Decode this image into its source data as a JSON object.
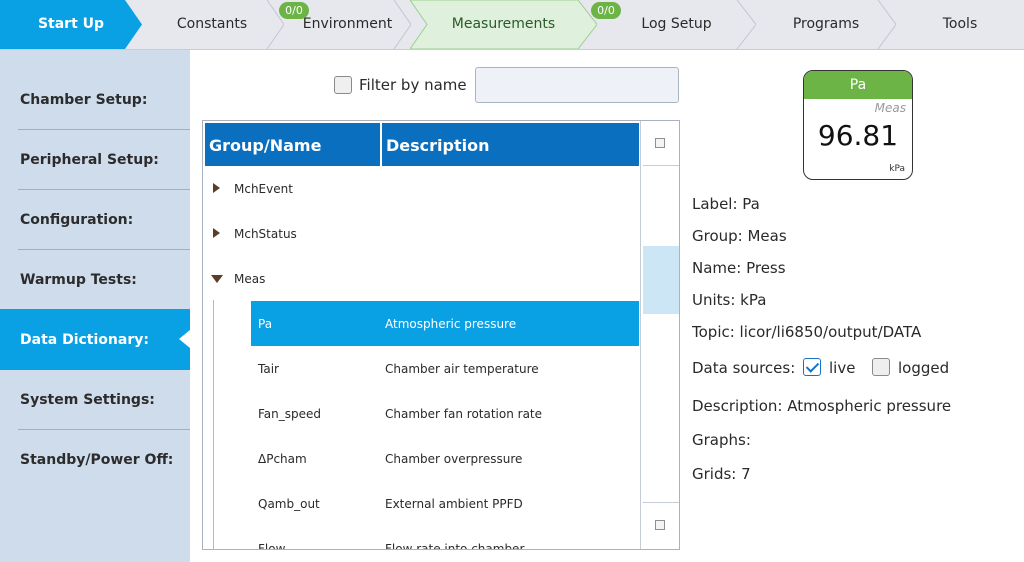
{
  "nav": {
    "tabs": [
      {
        "label": "Start Up"
      },
      {
        "label": "Constants"
      },
      {
        "label": "Environment",
        "badge": "0/0"
      },
      {
        "label": "Measurements"
      },
      {
        "label": "Log Setup",
        "badge": "0/0"
      },
      {
        "label": "Programs"
      },
      {
        "label": "Tools"
      }
    ]
  },
  "sidebar": {
    "items": [
      {
        "label": "Chamber Setup:"
      },
      {
        "label": "Peripheral Setup:"
      },
      {
        "label": "Configuration:"
      },
      {
        "label": "Warmup Tests:"
      },
      {
        "label": "Data Dictionary:"
      },
      {
        "label": "System Settings:"
      },
      {
        "label": "Standby/Power Off:"
      }
    ],
    "active_index": 4
  },
  "filter": {
    "label": "Filter by name",
    "value": "",
    "checked": false
  },
  "table": {
    "headers": {
      "name": "Group/Name",
      "description": "Description"
    },
    "rows": [
      {
        "name": "MchEvent",
        "description": ""
      },
      {
        "name": "MchStatus",
        "description": ""
      },
      {
        "name": "Meas",
        "description": ""
      },
      {
        "name": "Pa",
        "description": "Atmospheric pressure"
      },
      {
        "name": "Tair",
        "description": "Chamber air temperature"
      },
      {
        "name": "Fan_speed",
        "description": "Chamber fan rotation rate"
      },
      {
        "name": "ΔPcham",
        "description": "Chamber overpressure"
      },
      {
        "name": "Qamb_out",
        "description": "External ambient PPFD"
      },
      {
        "name": "Flow",
        "description": "Flow rate into chamber"
      }
    ]
  },
  "gauge": {
    "label": "Pa",
    "group": "Meas",
    "value": "96.81",
    "unit": "kPa"
  },
  "details": {
    "label": "Label:  Pa",
    "group": "Group:  Meas",
    "name": "Name:  Press",
    "units": "Units:  kPa",
    "topic": "Topic: licor/li6850/output/DATA",
    "sources_label": "Data sources:",
    "live_label": "live",
    "live_checked": true,
    "logged_label": "logged",
    "logged_checked": false,
    "description": "Description:  Atmospheric pressure",
    "graphs": "Graphs:",
    "grids": "Grids:  7"
  },
  "colors": {
    "accent_blue": "#0aa1e4",
    "header_blue": "#0b6fbf",
    "badge_green": "#6cb446",
    "active_tab_green": "#dff0dc",
    "sidebar_bg": "#cfdcec"
  }
}
